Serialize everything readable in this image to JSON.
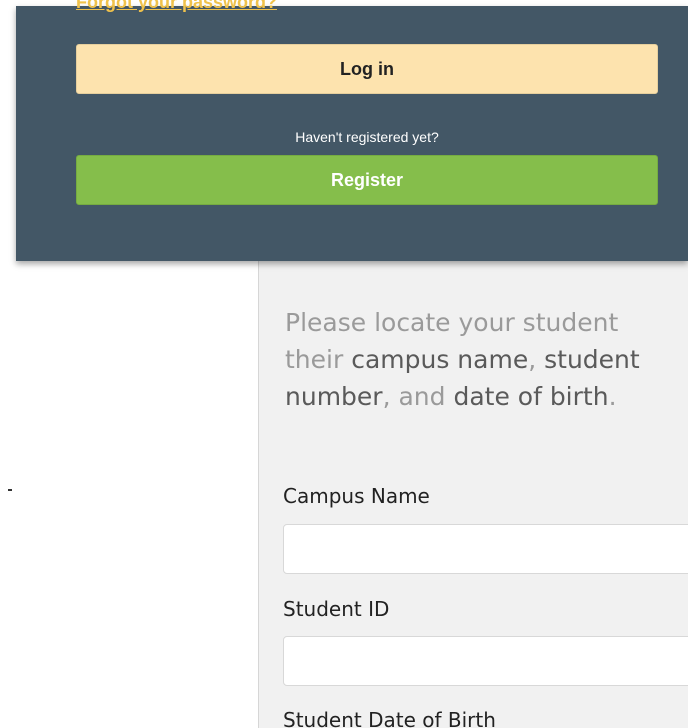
{
  "login_dropdown": {
    "forgot_password_link": "Forgot your password?",
    "login_button": "Log in",
    "register_hint": "Haven't registered yet?",
    "register_button": "Register"
  },
  "student_lookup": {
    "intro": {
      "part1": "Please locate your student",
      "part2": "their ",
      "campus_name": "campus name",
      "comma1": ", ",
      "student": "student",
      "number": "number",
      "and": ", and ",
      "date_of_birth": "date of birth",
      "period": "."
    },
    "fields": {
      "campus_name_label": "Campus Name",
      "campus_name_value": "",
      "student_id_label": "Student ID",
      "student_id_value": "",
      "dob_label": "Student Date of Birth"
    }
  },
  "colors": {
    "dropdown_bg": "#435766",
    "login_button_bg": "#fde3ae",
    "register_button_bg": "#85be4b",
    "link_color": "#f0c24b",
    "form_panel_bg": "#f1f1f1"
  }
}
